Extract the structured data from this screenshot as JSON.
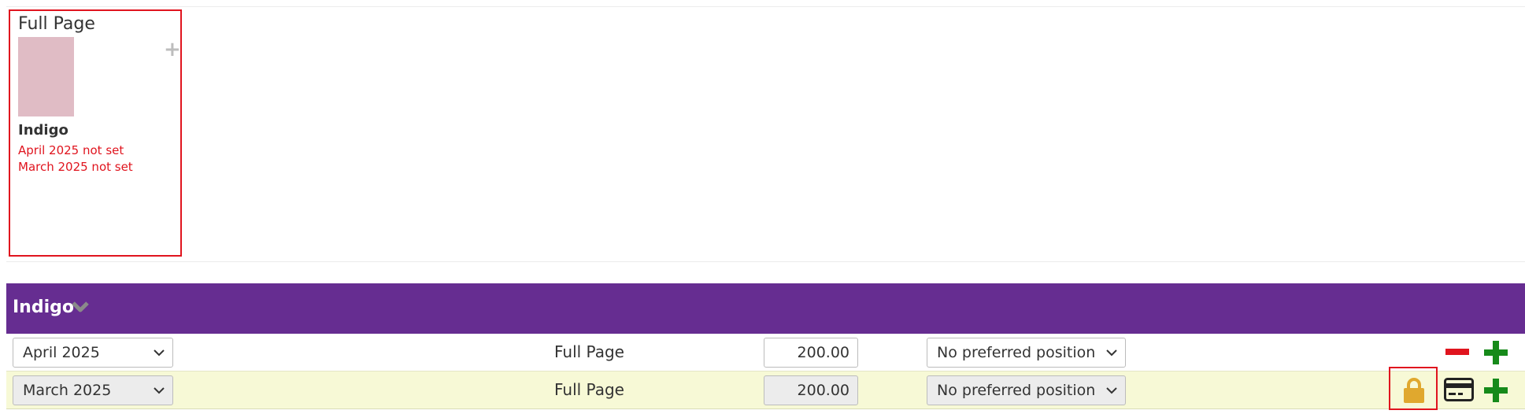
{
  "card": {
    "title": "Full Page",
    "name": "Indigo",
    "warnings": [
      "April 2025 not set",
      "March 2025 not set"
    ]
  },
  "group": {
    "title": "Indigo"
  },
  "rows": [
    {
      "month": "April 2025",
      "size": "Full Page",
      "price": "200.00",
      "position": "No preferred position",
      "locked": false
    },
    {
      "month": "March 2025",
      "size": "Full Page",
      "price": "200.00",
      "position": "No preferred position",
      "locked": true
    }
  ],
  "colors": {
    "accent": "#662d91",
    "warning": "#e0141e",
    "add": "#168a1a",
    "lock": "#e0a82e",
    "locked_row": "#f7f9d6"
  },
  "icons": [
    "plus-icon",
    "chevron-down-icon",
    "minus-icon",
    "lock-icon",
    "credit-card-icon"
  ]
}
